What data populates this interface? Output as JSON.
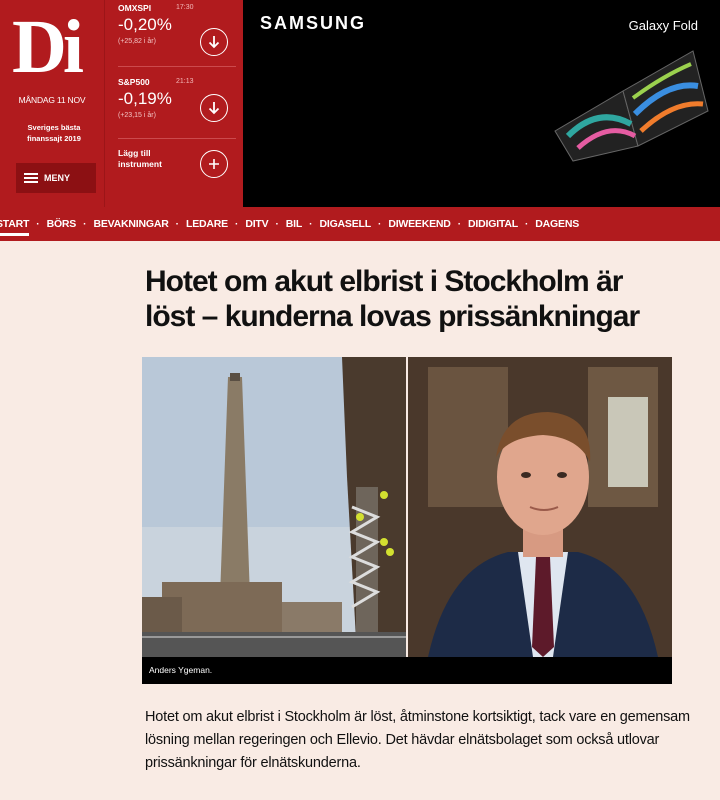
{
  "header": {
    "logo": "Di",
    "date": "MÅNDAG 11 NOV",
    "award": "Sveriges bästa finanssajt 2019",
    "menu_label": "MENY",
    "instruments": [
      {
        "name": "OMXSPI",
        "time": "17:30",
        "value": "-0,20%",
        "sub": "(+25,82 i år)"
      },
      {
        "name": "S&P500",
        "time": "21:13",
        "value": "-0,19%",
        "sub": "(+23,15 i år)"
      }
    ],
    "add_instrument_label": "Lägg till instrument"
  },
  "ad": {
    "brand": "SAMSUNG",
    "product": "Galaxy Fold"
  },
  "nav": {
    "items": [
      "START",
      "BÖRS",
      "BEVAKNINGAR",
      "LEDARE",
      "DITV",
      "BIL",
      "DIGASELL",
      "DIWEEKEND",
      "DIDIGITAL",
      "DAGENS"
    ]
  },
  "article": {
    "headline_line1": "Hotet om akut elbrist i Stockholm är",
    "headline_line2": "löst – kunderna lovas prissänkningar",
    "caption": "Anders Ygeman.",
    "lead": "Hotet om akut elbrist i Stockholm är löst, åtminstone kortsiktigt, tack vare en gemensam lösning mellan regeringen och Ellevio. Det hävdar elnätsbolaget som också utlovar prissänkningar för elnätskunderna."
  },
  "colors": {
    "brand_red": "#b11b1e",
    "page_bg": "#f9ebe4"
  }
}
